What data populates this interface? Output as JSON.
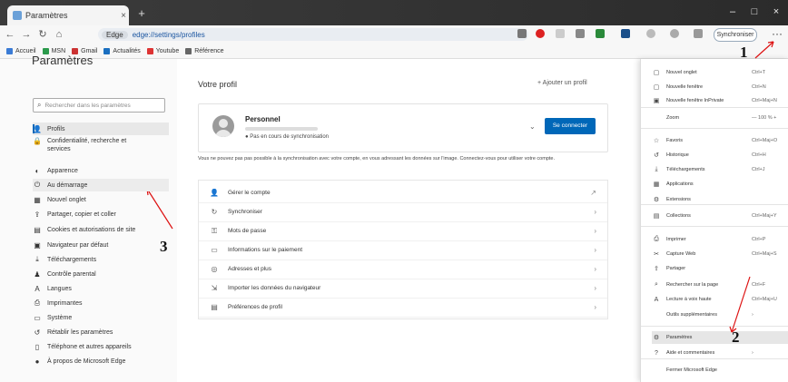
{
  "window": {
    "tab_title": "Paramètres",
    "tab_close": "×",
    "new_tab": "+",
    "minimize": "–",
    "maximize": "□",
    "close": "×"
  },
  "toolbar": {
    "back": "←",
    "forward": "→",
    "refresh": "↻",
    "home": "⌂",
    "site_chip": "Edge",
    "url": "edge://settings/profiles",
    "sync_label": "Synchroniser",
    "menu_label": "···"
  },
  "favorites": [
    {
      "label": "Accueil",
      "color": "#3a7bd5"
    },
    {
      "label": "MSN",
      "color": "#2b9a4b"
    },
    {
      "label": "Gmail",
      "color": "#c33"
    },
    {
      "label": "Actualités",
      "color": "#1a6fc0"
    },
    {
      "label": "Youtube",
      "color": "#d33"
    },
    {
      "label": "Référence",
      "color": "#666"
    }
  ],
  "sidebar": {
    "title": "Paramètres",
    "search_placeholder": "Rechercher dans les paramètres",
    "items": [
      {
        "label": "Profils",
        "icon": "👤"
      },
      {
        "label": "Confidentialité, recherche et services",
        "icon": "🔒"
      },
      {
        "label": "Apparence",
        "icon": "◐"
      },
      {
        "label": "Au démarrage",
        "icon": "⏻"
      },
      {
        "label": "Nouvel onglet",
        "icon": "▦"
      },
      {
        "label": "Partager, copier et coller",
        "icon": "⇪"
      },
      {
        "label": "Cookies et autorisations de site",
        "icon": "▤"
      },
      {
        "label": "Navigateur par défaut",
        "icon": "▣"
      },
      {
        "label": "Téléchargements",
        "icon": "⤓"
      },
      {
        "label": "Contrôle parental",
        "icon": "♟"
      },
      {
        "label": "Langues",
        "icon": "A"
      },
      {
        "label": "Imprimantes",
        "icon": "⎙"
      },
      {
        "label": "Système",
        "icon": "▭"
      },
      {
        "label": "Rétablir les paramètres",
        "icon": "↺"
      },
      {
        "label": "Téléphone et autres appareils",
        "icon": "▯"
      },
      {
        "label": "À propos de Microsoft Edge",
        "icon": "●"
      }
    ]
  },
  "main": {
    "title": "Votre profil",
    "add_profile": "+ Ajouter un profil",
    "profile_name": "Personnel",
    "profile_sync": "● Pas en cours de synchronisation",
    "profile_chevron": "⌄",
    "connect_button": "Se connecter",
    "info_text": "Vous ne pouvez pas pas possible à la synchronisation avec votre compte, en vous adressant les données sur l'image. Connectez-vous pour utiliser votre compte.",
    "rows": [
      {
        "label": "Gérer le compte",
        "icon": "👤",
        "arrow": "↗"
      },
      {
        "label": "Synchroniser",
        "icon": "↻",
        "arrow": "›"
      },
      {
        "label": "Mots de passe",
        "icon": "⚿",
        "arrow": "›"
      },
      {
        "label": "Informations sur le paiement",
        "icon": "▭",
        "arrow": "›"
      },
      {
        "label": "Adresses et plus",
        "icon": "◎",
        "arrow": "›"
      },
      {
        "label": "Importer les données du navigateur",
        "icon": "⇲",
        "arrow": "›"
      },
      {
        "label": "Préférences de profil",
        "icon": "▤",
        "arrow": "›"
      }
    ]
  },
  "dropdown": {
    "items": [
      {
        "label": "Nouvel onglet",
        "icon": "▢",
        "shortcut": "Ctrl+T"
      },
      {
        "label": "Nouvelle fenêtre",
        "icon": "▢",
        "shortcut": "Ctrl+N"
      },
      {
        "label": "Nouvelle fenêtre InPrivate",
        "icon": "▣",
        "shortcut": "Ctrl+Maj+N"
      },
      {
        "label": "Zoom",
        "icon": "",
        "shortcut": "— 100 % +"
      },
      {
        "label": "Favoris",
        "icon": "☆",
        "shortcut": "Ctrl+Maj+O"
      },
      {
        "label": "Historique",
        "icon": "↺",
        "shortcut": "Ctrl+H"
      },
      {
        "label": "Téléchargements",
        "icon": "⤓",
        "shortcut": "Ctrl+J"
      },
      {
        "label": "Applications",
        "icon": "▦",
        "shortcut": ""
      },
      {
        "label": "Extensions",
        "icon": "⚙",
        "shortcut": ""
      },
      {
        "label": "Collections",
        "icon": "▤",
        "shortcut": "Ctrl+Maj+Y"
      },
      {
        "label": "Imprimer",
        "icon": "⎙",
        "shortcut": "Ctrl+P"
      },
      {
        "label": "Capture Web",
        "icon": "✂",
        "shortcut": "Ctrl+Maj+S"
      },
      {
        "label": "Partager",
        "icon": "⇪",
        "shortcut": ""
      },
      {
        "label": "Rechercher sur la page",
        "icon": "⌕",
        "shortcut": "Ctrl+F"
      },
      {
        "label": "Lecture à voix haute",
        "icon": "A",
        "shortcut": "Ctrl+Maj+U"
      },
      {
        "label": "Outils supplémentaires",
        "icon": "",
        "shortcut": "›"
      },
      {
        "label": "Paramètres",
        "icon": "⚙",
        "shortcut": ""
      },
      {
        "label": "Aide et commentaires",
        "icon": "?",
        "shortcut": "›"
      },
      {
        "label": "Fermer Microsoft Edge",
        "icon": "",
        "shortcut": ""
      }
    ]
  },
  "annotations": [
    "1",
    "2",
    "3"
  ]
}
